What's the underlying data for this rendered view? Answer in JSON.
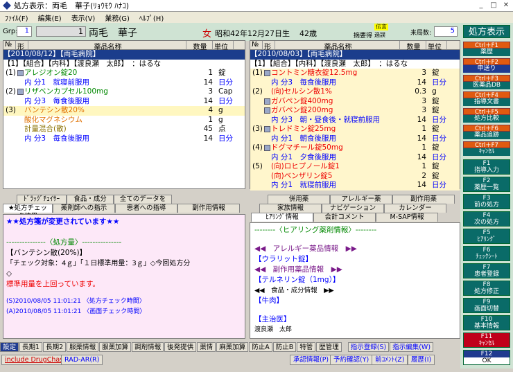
{
  "window": {
    "title": "処方表示：両毛　華子(ﾘｮｳﾓｳ ﾊﾅｺ)",
    "close": "✕",
    "minimize": "_",
    "maximize": "□"
  },
  "menu": [
    "ﾌｧｲﾙ(F)",
    "編集(E)",
    "表示(V)",
    "業務(G)",
    "ﾍﾙﾌﾟ(H)"
  ],
  "patient": {
    "grp_label": "Grp:",
    "grp": "1",
    "id": "1",
    "name": "両毛　華子",
    "sex": "女",
    "birth": "昭和42年12月27日生",
    "age": "42歳",
    "tag0": "摘要得",
    "tag1": "伝言",
    "tag2": "過誤",
    "visit_label": "来局数:",
    "visit": "5",
    "rx_button": "処方表示"
  },
  "left_rx": {
    "headers": [
      "№",
      "形",
      "薬品名称",
      "数量",
      "単位"
    ],
    "date": "【2010/08/12】【両毛病院】",
    "doctor": "【1】【組合】【内科】【渡良瀬　太郎】　：はるな",
    "rows": [
      {
        "no": "(1)",
        "name": "アレジオン錠20",
        "qty": "1",
        "unit": "錠",
        "cls": "green",
        "pill": true
      },
      {
        "no": "",
        "name": "内 分1　就寝前服用",
        "qty": "14",
        "unit": "日分",
        "cls": "blue",
        "pill": false
      },
      {
        "no": "(2)",
        "name": "リザベンカプセル100mg",
        "qty": "3",
        "unit": "Cap",
        "cls": "green",
        "pill": true
      },
      {
        "no": "",
        "name": "内 分3　毎食後服用",
        "qty": "14",
        "unit": "日分",
        "cls": "blue",
        "pill": false
      },
      {
        "no": "(3)",
        "name": "バンテシン散20%",
        "qty": "4",
        "unit": "g",
        "cls": "orange",
        "pill": false,
        "hl": true
      },
      {
        "no": "",
        "name": "酸化マグネシウム",
        "qty": "1",
        "unit": "g",
        "cls": "orange",
        "pill": false
      },
      {
        "no": "",
        "name": "計量混合(散)",
        "qty": "45",
        "unit": "点",
        "cls": "gold",
        "pill": false
      },
      {
        "no": "",
        "name": "内 分3　毎食後服用",
        "qty": "14",
        "unit": "日分",
        "cls": "blue",
        "pill": false
      }
    ]
  },
  "right_rx": {
    "headers": [
      "№",
      "形",
      "薬品名称",
      "数量",
      "単位"
    ],
    "date": "【2010/08/03】【両毛病院】",
    "doctor": "【1】【組合】【内科】【渡良瀬　太郎】　：はるな",
    "rows": [
      {
        "no": "(1)",
        "name": "コントミン糖衣錠12.5mg",
        "qty": "3",
        "unit": "錠",
        "cls": "red",
        "pill": true
      },
      {
        "no": "",
        "name": "内 分3　毎食後服用",
        "qty": "14",
        "unit": "日分",
        "cls": "blue",
        "pill": false
      },
      {
        "no": "(2)",
        "name": "(向)セルシン散1%",
        "qty": "0.3",
        "unit": "g",
        "cls": "red",
        "pill": false
      },
      {
        "no": "",
        "name": "ガバペン錠400mg",
        "qty": "3",
        "unit": "錠",
        "cls": "red",
        "pill": true
      },
      {
        "no": "",
        "name": "ガバペン錠200mg",
        "qty": "3",
        "unit": "錠",
        "cls": "red",
        "pill": true
      },
      {
        "no": "",
        "name": "内 分3　朝・昼食後・就寝前服用",
        "qty": "14",
        "unit": "日分",
        "cls": "blue",
        "pill": false
      },
      {
        "no": "(3)",
        "name": "トレドミン錠25mg",
        "qty": "1",
        "unit": "錠",
        "cls": "red",
        "pill": true
      },
      {
        "no": "",
        "name": "内 分1　朝食後服用",
        "qty": "14",
        "unit": "日分",
        "cls": "blue",
        "pill": false
      },
      {
        "no": "(4)",
        "name": "ドグマチール錠50mg",
        "qty": "1",
        "unit": "錠",
        "cls": "red",
        "pill": true
      },
      {
        "no": "",
        "name": "内 分1　夕食後服用",
        "qty": "14",
        "unit": "日分",
        "cls": "blue",
        "pill": false
      },
      {
        "no": "(5)",
        "name": "(向)ロヒプノール錠1",
        "qty": "1",
        "unit": "錠",
        "cls": "red",
        "pill": false
      },
      {
        "no": "",
        "name": "(向)ベンザリン錠5",
        "qty": "2",
        "unit": "錠",
        "cls": "red",
        "pill": false
      },
      {
        "no": "",
        "name": "内 分1　就寝前服用",
        "qty": "14",
        "unit": "日分",
        "cls": "blue",
        "pill": false
      }
    ]
  },
  "left_tabs": {
    "row1": [
      "ﾄﾞﾗｯｸﾞﾁｪｲｻｰ",
      "食品・成分",
      "全てのデータを表示"
    ],
    "row2": [
      "★処方チェック結果",
      "薬剤師への指示",
      "患者への指導",
      "副作用情報"
    ]
  },
  "right_tabs": {
    "row1": [
      "併用薬",
      "アレルギー薬",
      "副作用薬"
    ],
    "row2": [
      "家族情報",
      "ナビゲーション",
      "カレンダー"
    ],
    "row3": [
      "ﾋｱﾘﾝｸﾞ情報",
      "会計コメント",
      "M-SAP情報"
    ]
  },
  "left_content": {
    "alert": "★★処方箋が変更されています★★",
    "section": "---------------〈処方量〉---------------",
    "drug": "【バンテシン散(20%)】",
    "check": "「チェック対象：4ｇ」「１日標準用量：3ｇ」◇今回処方分",
    "diamond": "◇",
    "warn": "標準用量を上回っています。",
    "s_time": "(S)2010/08/05 11:01:21 〈処方チェック時間〉",
    "a_time": "(A)2010/08/05 11:01:21 〈画面チェック時間〉"
  },
  "right_content": {
    "title": "--------〈ヒアリング薬剤情報〉--------",
    "allergy_h": "◀◀　アレルギー薬品情報　▶▶",
    "allergy": "【ウラリット錠】",
    "side_h": "◀◀　副作用薬品情報　▶▶",
    "side": "【テルネリン錠（1mg）】",
    "food_h": "◀◀　食品・成分情報　▶▶",
    "food": "【牛肉】",
    "doctor_h": "【主治医】",
    "doctor": "渡良瀬　太郎"
  },
  "fkeys_top": [
    {
      "k": "Ctrl＋F1",
      "l": "薬歴"
    },
    {
      "k": "Ctrl＋F2",
      "l": "申送り"
    },
    {
      "k": "Ctrl＋F3",
      "l": "医薬品DB"
    },
    {
      "k": "Ctrl＋F4",
      "l": "指導文書"
    },
    {
      "k": "Ctrl＋F5",
      "l": "処方比較"
    },
    {
      "k": "Ctrl＋F6",
      "l": "薬品追跡"
    },
    {
      "k": "Ctrl＋F7",
      "l": "ｷｬﾝｾﾙ"
    }
  ],
  "fkeys": [
    {
      "k": "F1",
      "l": "指導入力"
    },
    {
      "k": "F2",
      "l": "薬歴一覧"
    },
    {
      "k": "F3",
      "l": "前の処方"
    },
    {
      "k": "F4",
      "l": "次の処方"
    },
    {
      "k": "F5",
      "l": "ﾋｱﾘﾝｸﾞ"
    },
    {
      "k": "F6",
      "l": "ﾁｪｯｸｼｰﾄ"
    },
    {
      "k": "F7",
      "l": "患者登録"
    },
    {
      "k": "F8",
      "l": "処方修正"
    },
    {
      "k": "F9",
      "l": "画面切替"
    },
    {
      "k": "F10",
      "l": "基本情報"
    },
    {
      "k": "F11",
      "l": "ｷｬﾝｾﾙ"
    },
    {
      "k": "F12",
      "l": "OK"
    }
  ],
  "bottom_buttons": [
    "設定",
    "長期1",
    "長期2",
    "服薬情報",
    "服薬加算",
    "調剤情報",
    "後発提供",
    "薬情",
    "麻薬加算",
    "防止A",
    "防止B",
    "特管",
    "歴管理",
    "指示登録(S)",
    "指示編集(W)"
  ],
  "status": {
    "drugchaser": "include DrugChaser",
    "radar": "RAD-AR(R)",
    "shonin": "承認情報(P)",
    "yoyaku": "予約確認(Y)",
    "comment": "前ｺﾒﾝﾄ(Z)",
    "rireki": "履歴(I)"
  }
}
